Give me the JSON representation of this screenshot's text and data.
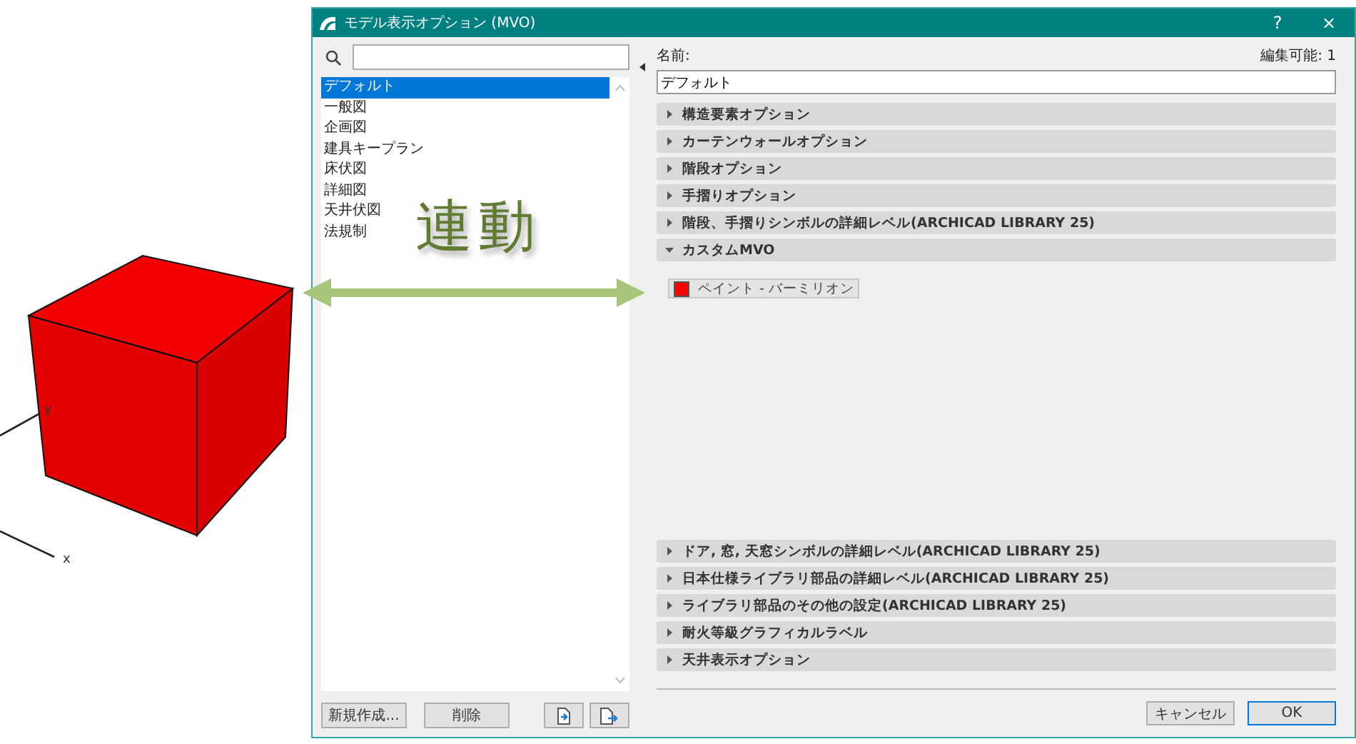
{
  "annotation": {
    "text": "連動"
  },
  "viewport": {
    "axis_labels": [
      "y",
      "x"
    ]
  },
  "dialog": {
    "title": "モデル表示オプション (MVO)",
    "title_buttons": [
      "?",
      "×"
    ],
    "list": [
      {
        "label": "デフォルト",
        "selected": true
      },
      {
        "label": "一般図",
        "selected": false
      },
      {
        "label": "企画図",
        "selected": false
      },
      {
        "label": "建具キープラン",
        "selected": false
      },
      {
        "label": "床伏図",
        "selected": false
      },
      {
        "label": "詳細図",
        "selected": false
      },
      {
        "label": "天井伏図",
        "selected": false
      },
      {
        "label": "法規制",
        "selected": false
      }
    ],
    "list_buttons": [
      "新規作成...",
      "削除"
    ],
    "name_label": "名前:",
    "editable": "編集可能: 1",
    "name_value": "デフォルト",
    "sections": [
      {
        "label": "構造要素オプション",
        "expanded": false
      },
      {
        "label": "カーテンウォールオプション",
        "expanded": false
      },
      {
        "label": "階段オプション",
        "expanded": false
      },
      {
        "label": "手摺りオプション",
        "expanded": false
      },
      {
        "label": "階段、手摺りシンボルの詳細レベル(ARCHICAD LIBRARY 25)",
        "expanded": false
      },
      {
        "label": "カスタムMVO",
        "expanded": true,
        "items": [
          {
            "kind": "surface",
            "label": "ペイント - バーミリオン",
            "color": "#ff0000"
          }
        ]
      },
      {
        "label": "ドア, 窓, 天窓シンボルの詳細レベル(ARCHICAD LIBRARY 25)",
        "expanded": false
      },
      {
        "label": "日本仕様ライブラリ部品の詳細レベル(ARCHICAD LIBRARY 25)",
        "expanded": false
      },
      {
        "label": "ライブラリ部品のその他の設定(ARCHICAD LIBRARY 25)",
        "expanded": false
      },
      {
        "label": "耐火等級グラフィカルラベル",
        "expanded": false
      },
      {
        "label": "天井表示オプション",
        "expanded": false
      }
    ],
    "buttons": [
      {
        "label": "キャンセル",
        "default": false
      },
      {
        "label": "OK",
        "default": true
      }
    ]
  }
}
